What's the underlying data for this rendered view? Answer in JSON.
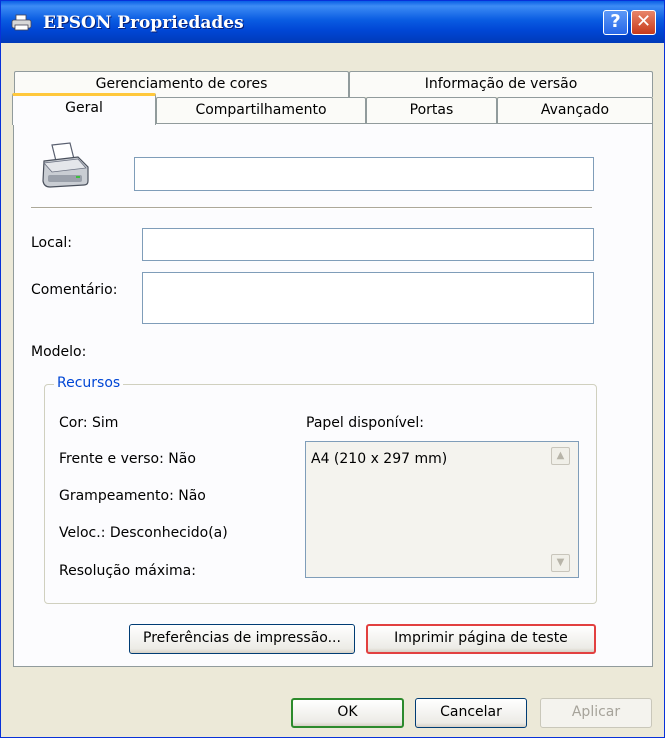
{
  "window": {
    "title": "EPSON Propriedades"
  },
  "titlebar": {
    "help_glyph": "?",
    "close_glyph": "✕"
  },
  "tabs": {
    "row_back": [
      {
        "label": "Gerenciamento de cores"
      },
      {
        "label": "Informação de versão"
      }
    ],
    "row_front": [
      {
        "label": "Geral",
        "active": true
      },
      {
        "label": "Compartilhamento"
      },
      {
        "label": "Portas"
      },
      {
        "label": "Avançado"
      }
    ]
  },
  "general": {
    "printer_name": "",
    "local_label": "Local:",
    "local_value": "",
    "comment_label": "Comentário:",
    "comment_value": "",
    "model_label": "Modelo:"
  },
  "features": {
    "group_title": "Recursos",
    "color": "Cor: Sim",
    "duplex": "Frente e verso: Não",
    "staple": "Grampeamento: Não",
    "speed": "Veloc.: Desconhecido(a)",
    "max_resolution": "Resolução máxima:",
    "paper_label": "Papel disponível:",
    "paper_items": [
      "A4 (210 x 297 mm)"
    ]
  },
  "buttons": {
    "preferences": "Preferências de impressão...",
    "test_page": "Imprimir página de teste",
    "ok": "OK",
    "cancel": "Cancelar",
    "apply": "Aplicar"
  },
  "icons": {
    "title": "printer-icon",
    "printer": "printer-icon",
    "scroll_up": "scroll-up-arrow-icon",
    "scroll_down": "scroll-down-arrow-icon"
  },
  "colors": {
    "titlebar": "#0a5ce2",
    "dialog_bg": "#ece9d8",
    "group_title": "#0046d5",
    "active_tab_accent": "#ffc83c",
    "focus_button_border": "#e24040",
    "default_button_border": "#2c8a2c"
  }
}
